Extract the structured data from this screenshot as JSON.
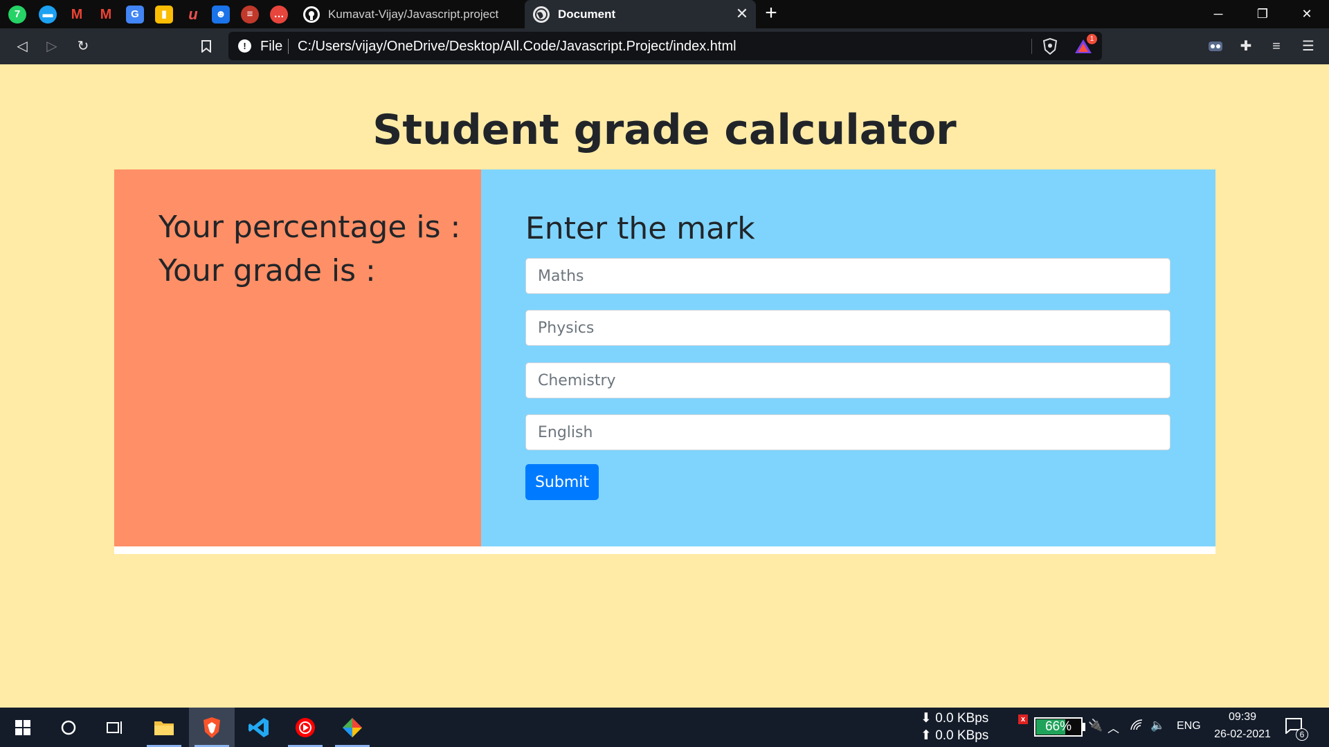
{
  "browser": {
    "pinned_tabs": [
      {
        "name": "whatsapp-pinned-tab",
        "glyph": "7",
        "color": "#25d366"
      },
      {
        "name": "messages-pinned-tab",
        "glyph": "",
        "color": "#1da1f2"
      },
      {
        "name": "gmail-pinned-tab-1",
        "glyph": "M",
        "color": "#ea4335"
      },
      {
        "name": "gmail-pinned-tab-2",
        "glyph": "M",
        "color": "#ea4335"
      },
      {
        "name": "translate-pinned-tab",
        "glyph": "G",
        "color": "#4285f4"
      },
      {
        "name": "keep-pinned-tab",
        "glyph": "",
        "color": "#fbbc04"
      },
      {
        "name": "udemy-pinned-tab",
        "glyph": "u",
        "color": "#ec5252"
      },
      {
        "name": "contacts-pinned-tab",
        "glyph": "",
        "color": "#1a73e8"
      },
      {
        "name": "app-pinned-tab",
        "glyph": "",
        "color": "#c0392b"
      },
      {
        "name": "chat-pinned-tab",
        "glyph": "",
        "color": "#e8453c"
      }
    ],
    "tabs": [
      {
        "label": "Kumavat-Vijay/Javascript.project"
      },
      {
        "label": "Document"
      }
    ],
    "address": {
      "scheme_label": "File",
      "url": "C:/Users/vijay/OneDrive/Desktop/All.Code/Javascript.Project/index.html"
    },
    "rewards_badge": "1"
  },
  "page": {
    "title": "Student grade calculator",
    "results": {
      "percentage_label": "Your percentage is :",
      "grade_label": "Your grade is :"
    },
    "form": {
      "title": "Enter the mark",
      "fields": [
        {
          "placeholder": "Maths"
        },
        {
          "placeholder": "Physics"
        },
        {
          "placeholder": "Chemistry"
        },
        {
          "placeholder": "English"
        }
      ],
      "submit_label": "Submit"
    },
    "colors": {
      "background": "#ffeba6",
      "left_panel": "#ff8f66",
      "right_panel": "#7fd4fd",
      "button": "#007bff"
    }
  },
  "taskbar": {
    "net_down": "⬇ 0.0 KBps",
    "net_up": "⬆ 0.0 KBps",
    "battery": "66%",
    "battery_level": 0.66,
    "language": "ENG",
    "time": "09:39",
    "date": "26-02-2021",
    "notification_count": "6"
  }
}
